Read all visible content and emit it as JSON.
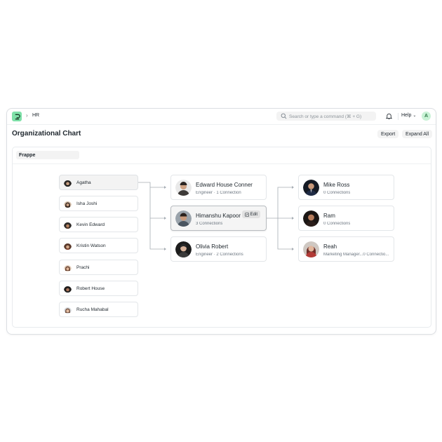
{
  "app": {
    "breadcrumb": "HR",
    "search_placeholder": "Search or type a command (⌘ + G)",
    "help_label": "Help",
    "user_initial": "A"
  },
  "page": {
    "title": "Organizational Chart",
    "export_label": "Export",
    "expand_all_label": "Expand All",
    "company": "Frappe"
  },
  "colors": {
    "logo": "#7ee0a8",
    "avatar_bg": "#c9f2d6",
    "connector": "#a6adb4"
  },
  "left_nodes": [
    {
      "name": "Agatha",
      "active": true
    },
    {
      "name": "Isha Joshi",
      "active": false
    },
    {
      "name": "Kevin Edward",
      "active": false
    },
    {
      "name": "Kristin Watson",
      "active": false
    },
    {
      "name": "Prachi",
      "active": false
    },
    {
      "name": "Robert House",
      "active": false
    },
    {
      "name": "Rucha Mahabal",
      "active": false
    }
  ],
  "middle_nodes": [
    {
      "name": "Edward House Conner",
      "subtitle": "Engineer · 1 Connection"
    },
    {
      "name": "Himanshu Kapoor",
      "subtitle": "3 Connections",
      "edit_label": "Edit"
    },
    {
      "name": "Olivia Robert",
      "subtitle": "Engineer · 2 Connections"
    }
  ],
  "right_nodes": [
    {
      "name": "Mike Ross",
      "subtitle": "0 Connections"
    },
    {
      "name": "Ram",
      "subtitle": "0 Connections"
    },
    {
      "name": "Reah",
      "subtitle": "Marketing Manager...0 Connectio..."
    }
  ]
}
